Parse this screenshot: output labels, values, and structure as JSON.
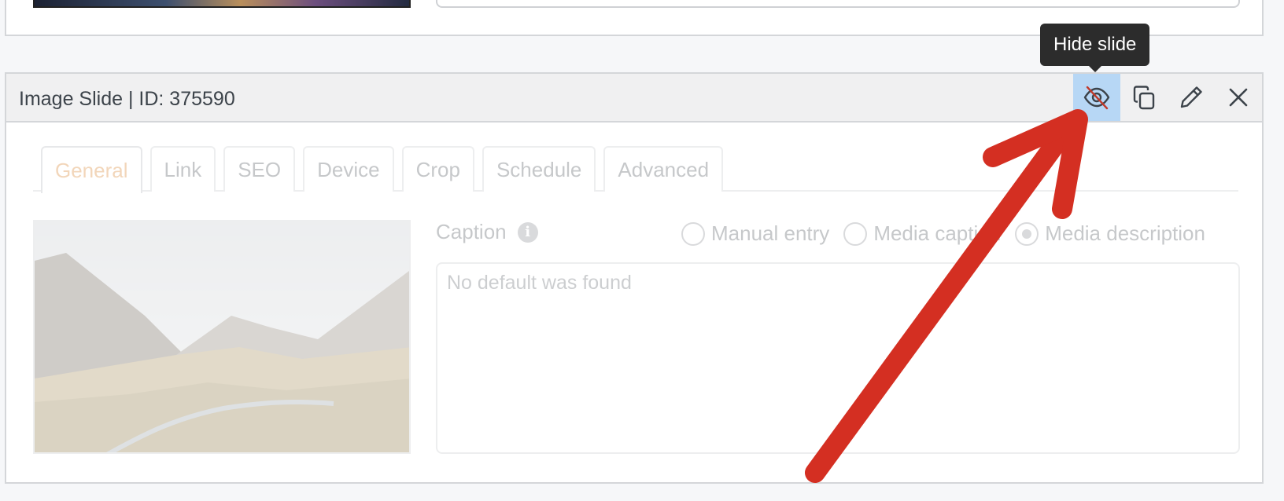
{
  "slide": {
    "title": "Image Slide | ID: 375590"
  },
  "header_actions": {
    "hide": "eye-slash-icon",
    "duplicate": "copy-icon",
    "edit": "pencil-icon",
    "delete": "close-icon"
  },
  "tooltip": {
    "text": "Hide slide"
  },
  "tabs": [
    {
      "label": "General",
      "active": true
    },
    {
      "label": "Link"
    },
    {
      "label": "SEO"
    },
    {
      "label": "Device"
    },
    {
      "label": "Crop"
    },
    {
      "label": "Schedule"
    },
    {
      "label": "Advanced"
    }
  ],
  "caption": {
    "label": "Caption",
    "info_icon": "info-icon",
    "options": [
      {
        "label": "Manual entry",
        "checked": false
      },
      {
        "label": "Media caption",
        "checked": false
      },
      {
        "label": "Media description",
        "checked": true
      }
    ],
    "placeholder": "No default was found"
  },
  "thumbnail": {
    "alt": "mountain-valley-image"
  },
  "colors": {
    "active_tab": "#d9822b",
    "hide_button_bg": "#b7d7f5",
    "arrow": "#d42f22"
  }
}
